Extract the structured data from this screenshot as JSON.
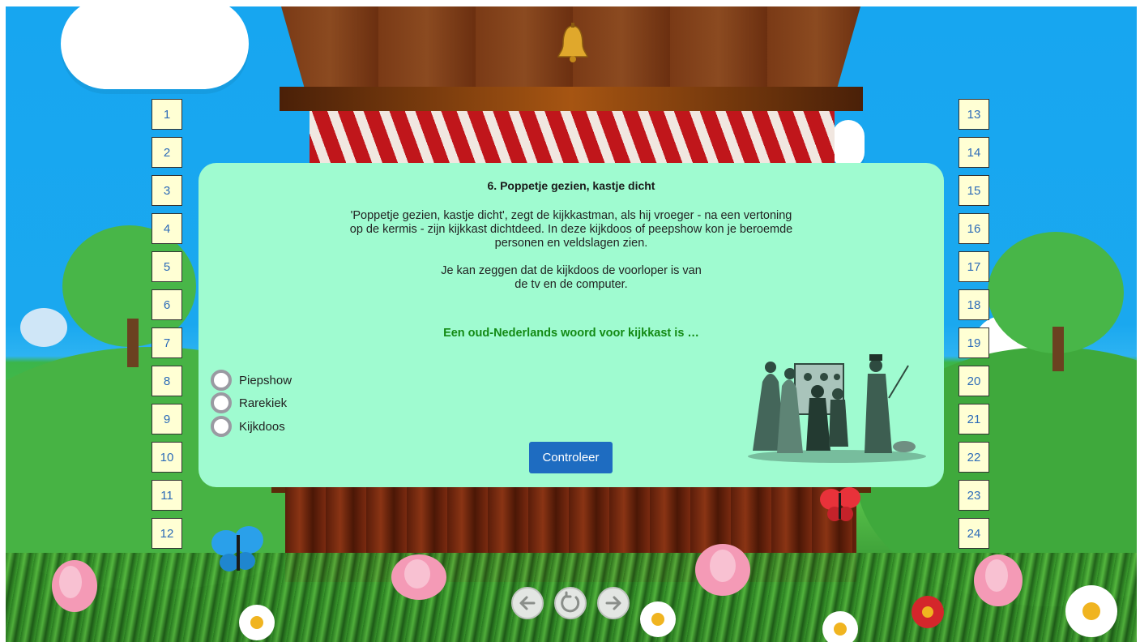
{
  "left_buttons": [
    "1",
    "2",
    "3",
    "4",
    "5",
    "6",
    "7",
    "8",
    "9",
    "10",
    "11",
    "12"
  ],
  "right_buttons": [
    "13",
    "14",
    "15",
    "16",
    "17",
    "18",
    "19",
    "20",
    "21",
    "22",
    "23",
    "24"
  ],
  "panel": {
    "title": "6. Poppetje gezien, kastje dicht",
    "paragraph1": "'Poppetje gezien, kastje dicht', zegt de kijkkastman, als hij vroeger - na een vertoning op de kermis - zijn kijkkast dichtdeed. In deze kijkdoos of peepshow kon je beroemde personen en veldslagen zien.",
    "paragraph2": "Je kan zeggen dat de kijkdoos de voorloper is van de tv en de computer.",
    "question": "Een oud-Nederlands woord voor kijkkast is …",
    "options": [
      "Piepshow",
      "Rarekiek",
      "Kijkdoos"
    ],
    "check_label": "Controleer"
  },
  "nav": {
    "prev_icon": "arrow-left-icon",
    "reset_icon": "reload-icon",
    "next_icon": "arrow-right-icon"
  },
  "colors": {
    "panel_bg": "#9ffbd0",
    "question_color": "#138a14",
    "button_blue": "#1e6cc1",
    "number_button_bg": "#ffffd4",
    "number_text": "#2c6bb8"
  }
}
